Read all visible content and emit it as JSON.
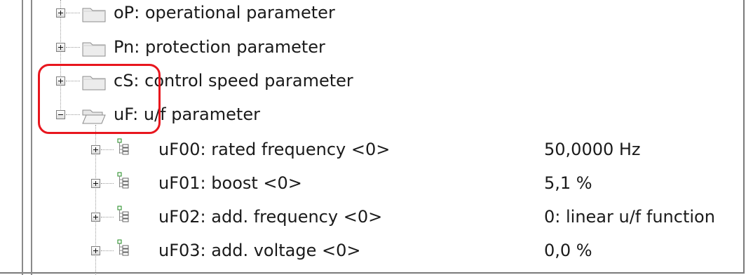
{
  "tree": {
    "groups": [
      {
        "label": "oP: operational parameter",
        "expanded": false
      },
      {
        "label": "Pn: protection parameter",
        "expanded": false
      },
      {
        "label": "cS: control speed parameter",
        "expanded": false
      },
      {
        "label": "uF: u/f parameter",
        "expanded": true
      }
    ],
    "params": [
      {
        "label": "uF00: rated frequency <0>",
        "value": "50,0000 Hz"
      },
      {
        "label": "uF01: boost <0>",
        "value": "5,1 %"
      },
      {
        "label": "uF02: add. frequency <0>",
        "value": "0: linear u/f function"
      },
      {
        "label": "uF03: add. voltage <0>",
        "value": "0,0 %"
      }
    ]
  },
  "annotation": {
    "color": "#e8161e"
  },
  "icons": {
    "folder": "folder-icon",
    "folder_open": "folder-open-icon",
    "parameter": "parameter-node-icon"
  }
}
